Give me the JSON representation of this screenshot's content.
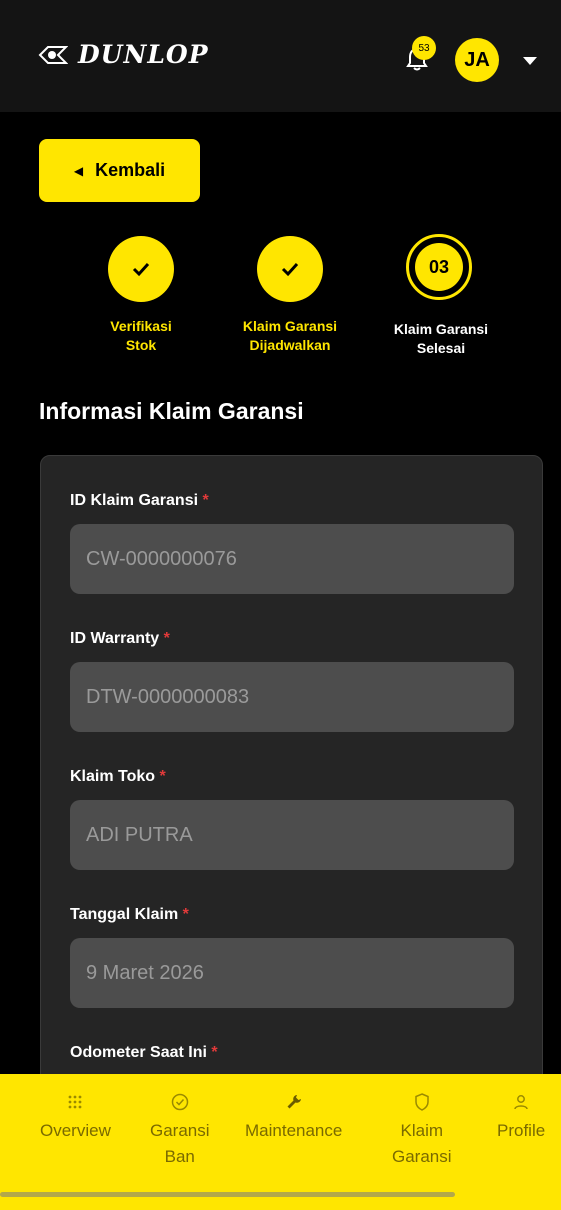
{
  "header": {
    "brand": "DUNLOP",
    "notification_count": "53",
    "avatar_initials": "JA"
  },
  "back_button": {
    "label": "Kembali"
  },
  "steps": [
    {
      "label_line1": "Verifikasi",
      "label_line2": "Stok",
      "status": "done"
    },
    {
      "label_line1": "Klaim Garansi",
      "label_line2": "Dijadwalkan",
      "status": "done"
    },
    {
      "number": "03",
      "label_line1": "Klaim Garansi",
      "label_line2": "Selesai",
      "status": "current"
    }
  ],
  "section_title": "Informasi Klaim Garansi",
  "form": {
    "fields": [
      {
        "label": "ID Klaim Garansi",
        "required_mark": "*",
        "value": "CW-0000000076"
      },
      {
        "label": "ID Warranty",
        "required_mark": "*",
        "value": "DTW-0000000083"
      },
      {
        "label": "Klaim Toko",
        "required_mark": "*",
        "value": "ADI PUTRA"
      },
      {
        "label": "Tanggal Klaim",
        "required_mark": "*",
        "value": "9 Maret 2026"
      },
      {
        "label": "Odometer Saat Ini",
        "required_mark": "*"
      }
    ]
  },
  "bottom_nav": {
    "items": [
      {
        "label_line1": "Overview",
        "label_line2": "",
        "icon": "grid-icon"
      },
      {
        "label_line1": "Garansi",
        "label_line2": "Ban",
        "icon": "badge-check-icon"
      },
      {
        "label_line1": "Maintenance",
        "label_line2": "",
        "icon": "wrench-icon"
      },
      {
        "label_line1": "Klaim",
        "label_line2": "Garansi",
        "icon": "shield-icon"
      },
      {
        "label_line1": "Profile",
        "label_line2": "",
        "icon": "user-icon"
      }
    ]
  },
  "colors": {
    "accent": "#ffe600",
    "background": "#000000",
    "header": "#141414",
    "card": "#252525",
    "input": "#4d4d4d",
    "required": "#e23a3a"
  }
}
